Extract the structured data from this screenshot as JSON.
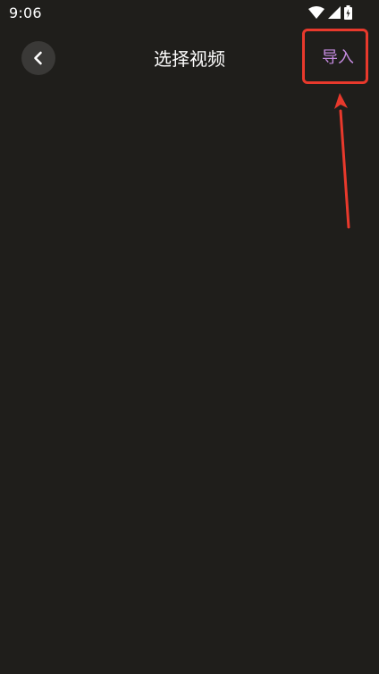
{
  "status_bar": {
    "time": "9:06",
    "icons": [
      "wifi-icon",
      "signal-icon",
      "battery-icon"
    ]
  },
  "header": {
    "back_icon": "chevron-left-icon",
    "title": "选择视频",
    "import_label": "导入"
  },
  "colors": {
    "background": "#1f1e1b",
    "back_button_bg": "#3a3937",
    "import_label": "#c58be0",
    "annotation": "#e8392c"
  },
  "content": {
    "videos": []
  }
}
